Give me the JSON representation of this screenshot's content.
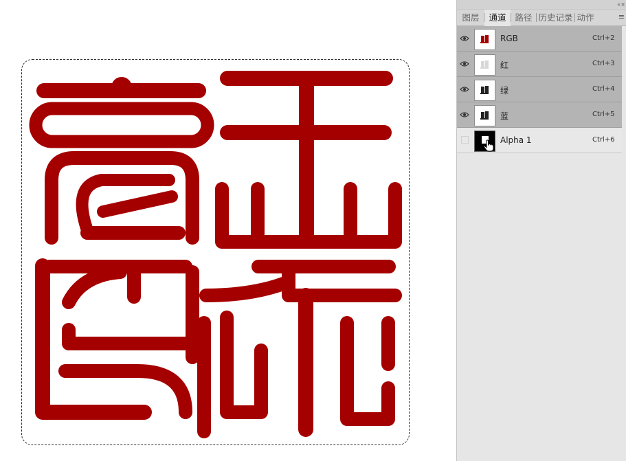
{
  "canvas": {
    "seal_color": "#a50000",
    "selection": "marquee"
  },
  "panel": {
    "topbar": {
      "collapse_icon": "«",
      "close_icon": "×"
    },
    "tabs": [
      {
        "label": "图层",
        "active": false
      },
      {
        "label": "通道",
        "active": true
      },
      {
        "label": "路径",
        "active": false
      },
      {
        "label": "历史记录",
        "active": false
      },
      {
        "label": "动作",
        "active": false
      }
    ],
    "menu_icon": "≡",
    "channels": [
      {
        "name": "RGB",
        "shortcut": "Ctrl+2",
        "visible": true,
        "selected": true
      },
      {
        "name": "红",
        "shortcut": "Ctrl+3",
        "visible": true,
        "selected": true
      },
      {
        "name": "绿",
        "shortcut": "Ctrl+4",
        "visible": true,
        "selected": true
      },
      {
        "name": "蓝",
        "shortcut": "Ctrl+5",
        "visible": true,
        "selected": true
      },
      {
        "name": "Alpha 1",
        "shortcut": "Ctrl+6",
        "visible": false,
        "selected": false
      }
    ]
  }
}
